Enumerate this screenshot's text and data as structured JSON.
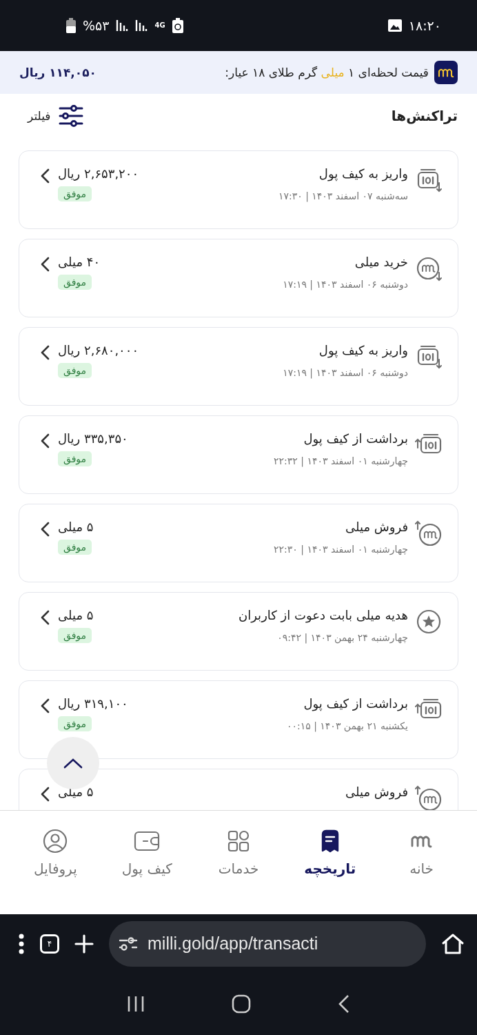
{
  "status_bar": {
    "time": "۱۸:۲۰",
    "battery": "%۵۳",
    "network": "4G"
  },
  "price_banner": {
    "label_before": "قیمت لحظه‌ای ۱",
    "label_highlight": "میلی",
    "label_after": "گرم طلای ۱۸ عیار:",
    "price": "۱۱۴,۰۵۰ ریال"
  },
  "header": {
    "title": "تراکنش‌ها",
    "filter": "فیلتر"
  },
  "transactions": [
    {
      "kind": "wallet_deposit",
      "title": "واریز به کیف پول",
      "date": "سه‌شنبه ۰۷ اسفند ۱۴۰۳ | ۱۷:۳۰",
      "amount": "۲,۶۵۳,۲۰۰ ریال",
      "status": "موفق"
    },
    {
      "kind": "milli_buy",
      "title": "خرید میلی",
      "date": "دوشنبه ۰۶ اسفند ۱۴۰۳ | ۱۷:۱۹",
      "amount": "۴۰ میلی",
      "status": "موفق"
    },
    {
      "kind": "wallet_deposit",
      "title": "واریز به کیف پول",
      "date": "دوشنبه ۰۶ اسفند ۱۴۰۳ | ۱۷:۱۹",
      "amount": "۲,۶۸۰,۰۰۰ ریال",
      "status": "موفق"
    },
    {
      "kind": "wallet_withdraw",
      "title": "برداشت از کیف پول",
      "date": "چهارشنبه ۰۱ اسفند ۱۴۰۳ | ۲۲:۳۲",
      "amount": "۳۳۵,۳۵۰ ریال",
      "status": "موفق"
    },
    {
      "kind": "milli_sell",
      "title": "فروش میلی",
      "date": "چهارشنبه ۰۱ اسفند ۱۴۰۳ | ۲۲:۳۰",
      "amount": "۵ میلی",
      "status": "موفق"
    },
    {
      "kind": "gift",
      "title": "هدیه میلی بابت دعوت از کاربران",
      "date": "چهارشنبه ۲۴ بهمن ۱۴۰۳ | ۰۹:۴۲",
      "amount": "۵ میلی",
      "status": "موفق"
    },
    {
      "kind": "wallet_withdraw",
      "title": "برداشت از کیف پول",
      "date": "یکشنبه ۲۱ بهمن ۱۴۰۳ | ۰۰:۱۵",
      "amount": "۳۱۹,۱۰۰ ریال",
      "status": "موفق"
    },
    {
      "kind": "milli_sell",
      "title": "فروش میلی",
      "amount": "۵ میلی"
    }
  ],
  "bottom_nav": [
    {
      "kind": "home",
      "label": "خانه",
      "selected": false
    },
    {
      "kind": "history",
      "label": "تاریخچه",
      "selected": true
    },
    {
      "kind": "services",
      "label": "خدمات",
      "selected": false
    },
    {
      "kind": "wallet",
      "label": "کیف پول",
      "selected": false
    },
    {
      "kind": "profile",
      "label": "پروفایل",
      "selected": false
    }
  ],
  "browser": {
    "url": "milli.gold/app/transacti",
    "tab_count": "۴"
  }
}
